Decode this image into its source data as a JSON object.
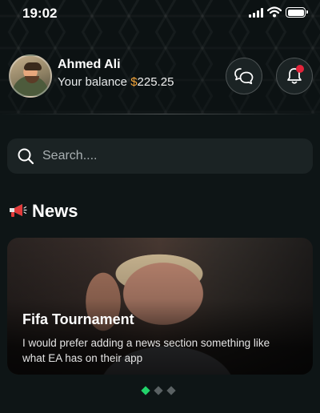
{
  "status_bar": {
    "time": "19:02"
  },
  "profile": {
    "name": "Ahmed Ali",
    "balance_label": "Your balance ",
    "currency": "$",
    "balance": "225.25"
  },
  "search": {
    "placeholder": "Search...."
  },
  "news": {
    "heading": "News",
    "cards": [
      {
        "title": "Fifa Tournament",
        "text": "I would prefer adding a news section something like what EA has on their app"
      }
    ],
    "carousel": {
      "count": 3,
      "active_index": 0
    }
  },
  "colors": {
    "background": "#0e1516",
    "accent_currency": "#f1a43a",
    "notification_dot": "#e4233a",
    "active_dot": "#22d36b"
  },
  "icons": [
    "signal-icon",
    "wifi-icon",
    "battery-icon",
    "chat-icon",
    "bell-icon",
    "search-icon",
    "megaphone-icon"
  ]
}
